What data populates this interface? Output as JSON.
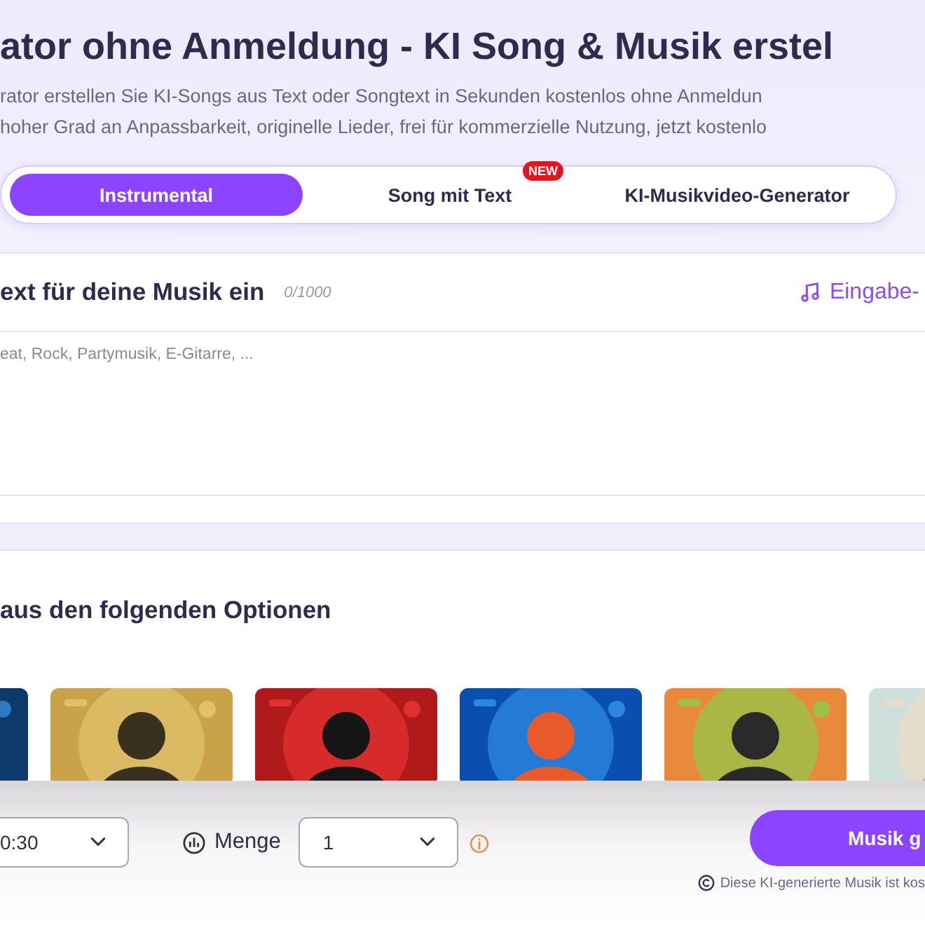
{
  "header": {
    "title": "ator ohne Anmeldung - KI Song & Musik erstel",
    "description": [
      "rator erstellen Sie KI-Songs aus Text oder Songtext in Sekunden kostenlos ohne Anmeldun",
      "hoher Grad an Anpassbarkeit, originelle Lieder, frei für kommerzielle Nutzung, jetzt kostenlo"
    ]
  },
  "mode_tabs": [
    {
      "label": "Instrumental",
      "selected": true
    },
    {
      "label": "Song mit Text",
      "selected": false,
      "badge": "NEW"
    },
    {
      "label": "KI-Musikvideo-Generator",
      "selected": false
    }
  ],
  "prompt": {
    "heading": "ext für deine Musik ein",
    "counter": "0/1000",
    "link": "Eingabe-",
    "placeholder": "eat, Rock, Partymusik, E-Gitarre, ..."
  },
  "options": {
    "heading": "aus den folgenden Optionen"
  },
  "controls": {
    "duration": "0:30",
    "quantity_label": "Menge",
    "quantity": "1",
    "generate_button": "Musik g",
    "notice": "Diese KI-generierte Musik ist kos"
  }
}
